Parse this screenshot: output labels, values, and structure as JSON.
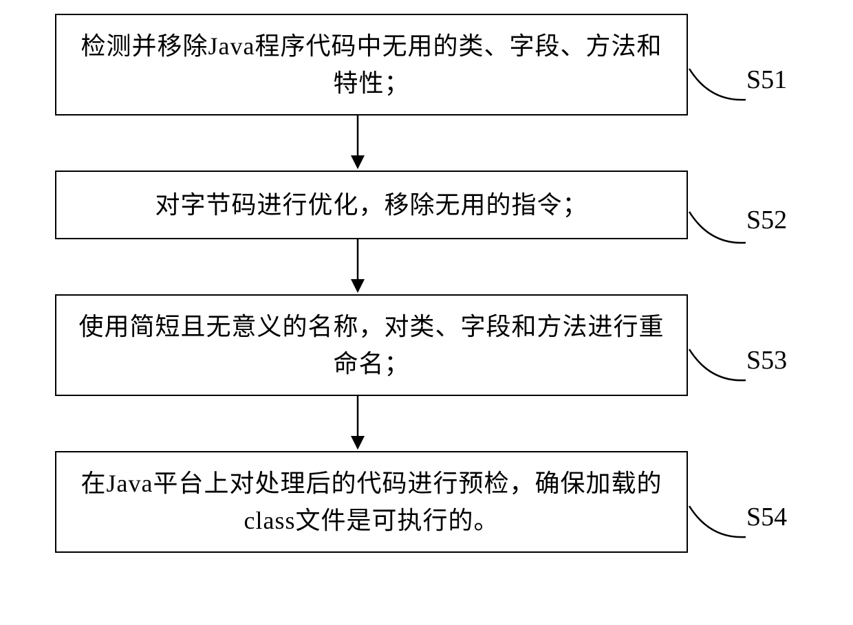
{
  "steps": [
    {
      "label": "S51",
      "text": "检测并移除Java程序代码中无用的类、字段、方法和特性；"
    },
    {
      "label": "S52",
      "text": "对字节码进行优化，移除无用的指令；"
    },
    {
      "label": "S53",
      "text": "使用简短且无意义的名称，对类、字段和方法进行重命名；"
    },
    {
      "label": "S54",
      "text": "在Java平台上对处理后的代码进行预检，确保加载的class文件是可执行的。"
    }
  ]
}
